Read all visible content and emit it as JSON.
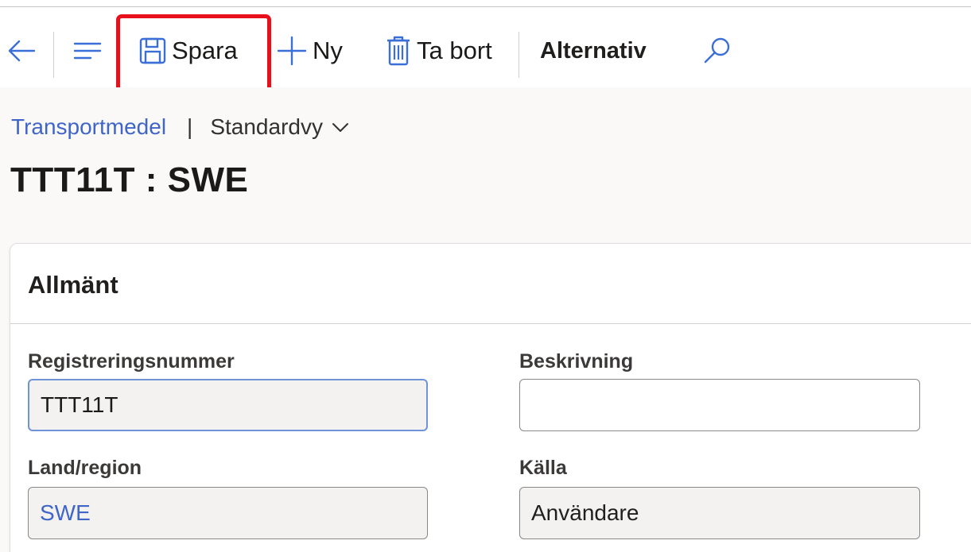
{
  "toolbar": {
    "save_label": "Spara",
    "new_label": "Ny",
    "delete_label": "Ta bort",
    "options_label": "Alternativ"
  },
  "icons": {
    "back": "arrow-left-icon",
    "menu": "hamburger-menu-icon",
    "save": "save-disk-icon",
    "new": "plus-icon",
    "delete": "trash-icon",
    "search": "search-icon",
    "view_dropdown": "chevron-down-icon"
  },
  "breadcrumb": {
    "link": "Transportmedel",
    "divider": "|",
    "view": "Standardvy"
  },
  "page": {
    "title": "TTT11T : SWE"
  },
  "card": {
    "title": "Allmänt",
    "fields": {
      "registration_label": "Registreringsnummer",
      "registration_value": "TTT11T",
      "description_label": "Beskrivning",
      "description_value": "",
      "country_label": "Land/region",
      "country_value": "SWE",
      "source_label": "Källa",
      "source_value": "Användare"
    }
  },
  "colors": {
    "accent_link": "#3f65c8",
    "highlight": "#e8101b",
    "focus_border": "#6f93d8",
    "readonly_bg": "#f3f2f1"
  }
}
